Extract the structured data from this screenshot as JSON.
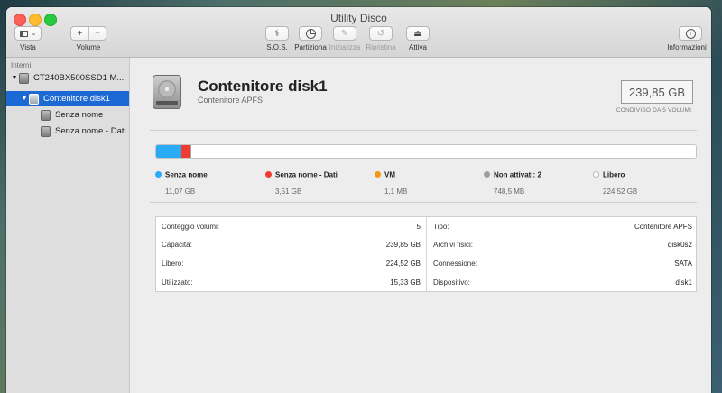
{
  "window": {
    "title": "Utility Disco"
  },
  "toolbar": {
    "vista": "Vista",
    "volume": "Volume",
    "sos": "S.O.S.",
    "partiziona": "Partiziona",
    "inizializza": "Inizializza",
    "ripristina": "Ripristina",
    "attiva": "Attiva",
    "informazioni": "Informazioni",
    "plus": "+",
    "minus": "−"
  },
  "sidebar": {
    "header": "Interni",
    "items": [
      {
        "label": "CT240BX500SSD1 M...",
        "level": 0,
        "expanded": true
      },
      {
        "label": "Contenitore disk1",
        "level": 1,
        "expanded": true,
        "selected": true
      },
      {
        "label": "Senza nome",
        "level": 2
      },
      {
        "label": "Senza nome - Dati",
        "level": 2
      }
    ]
  },
  "volume": {
    "name": "Contenitore disk1",
    "type": "Contenitore APFS",
    "capacity": "239,85 GB",
    "capacity_note": "CONDIVISO DA 5 VOLUMI"
  },
  "usage": {
    "segments": [
      {
        "name": "Senza nome",
        "size": "11,07 GB",
        "color": "#29abf5",
        "fraction": 0.0461
      },
      {
        "name": "Senza nome - Dati",
        "size": "3,51 GB",
        "color": "#f03b32",
        "fraction": 0.0146
      },
      {
        "name": "VM",
        "size": "1,1 MB",
        "color": "#f29a12",
        "fraction": 0.0
      },
      {
        "name": "Non attivati: 2",
        "size": "748,5 MB",
        "color": "#9e9e9e",
        "fraction": 0.0031
      },
      {
        "name": "Libero",
        "size": "224,52 GB",
        "color": "#ffffff",
        "fraction": 0.9362
      }
    ]
  },
  "info": {
    "left": [
      {
        "key": "Conteggio volumi:",
        "value": "5"
      },
      {
        "key": "Capacità:",
        "value": "239,85 GB"
      },
      {
        "key": "Libero:",
        "value": "224,52 GB"
      },
      {
        "key": "Utilizzato:",
        "value": "15,33 GB"
      }
    ],
    "right": [
      {
        "key": "Tipo:",
        "value": "Contenitore APFS"
      },
      {
        "key": "Archivi fisici:",
        "value": "disk0s2"
      },
      {
        "key": "Connessione:",
        "value": "SATA"
      },
      {
        "key": "Dispositivo:",
        "value": "disk1"
      }
    ]
  }
}
